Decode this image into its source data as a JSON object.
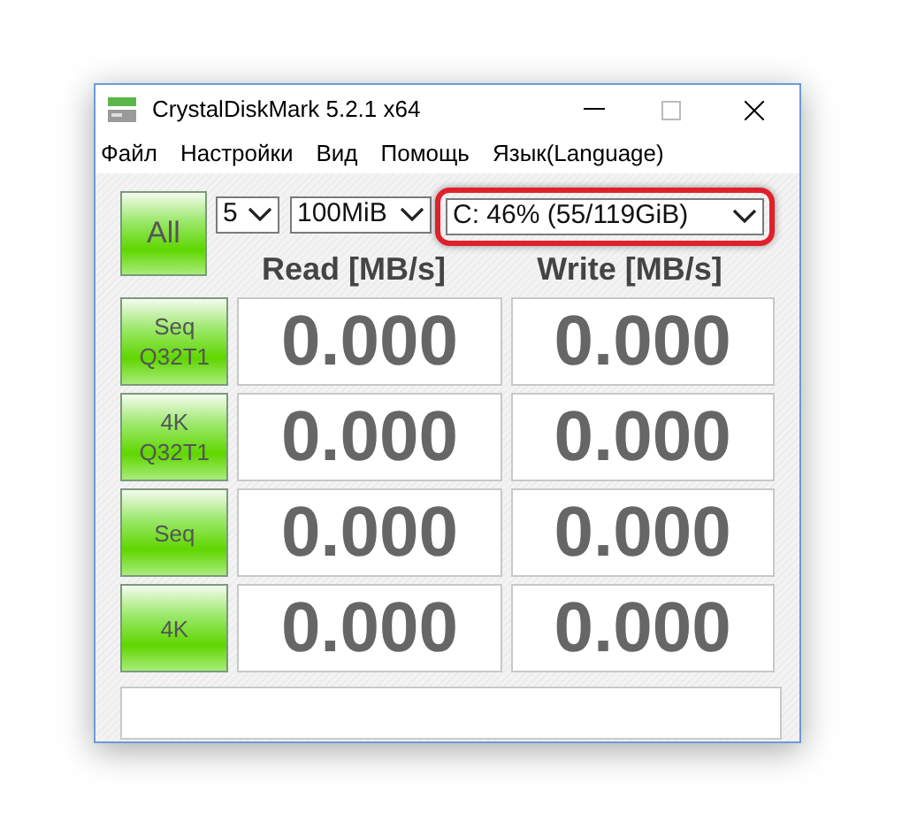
{
  "window": {
    "title": "CrystalDiskMark 5.2.1 x64"
  },
  "menu": [
    "Файл",
    "Настройки",
    "Вид",
    "Помощь",
    "Язык(Language)"
  ],
  "controls": {
    "all_button": "All",
    "count": "5",
    "size": "100MiB",
    "drive": "C: 46% (55/119GiB)",
    "drive_highlighted": true
  },
  "headers": [
    "Read [MB/s]",
    "Write [MB/s]"
  ],
  "rows": [
    {
      "label": [
        "Seq",
        "Q32T1"
      ],
      "read": "0.000",
      "write": "0.000"
    },
    {
      "label": [
        "4K",
        "Q32T1"
      ],
      "read": "0.000",
      "write": "0.000"
    },
    {
      "label": [
        "Seq"
      ],
      "read": "0.000",
      "write": "0.000"
    },
    {
      "label": [
        "4K"
      ],
      "read": "0.000",
      "write": "0.000"
    }
  ]
}
